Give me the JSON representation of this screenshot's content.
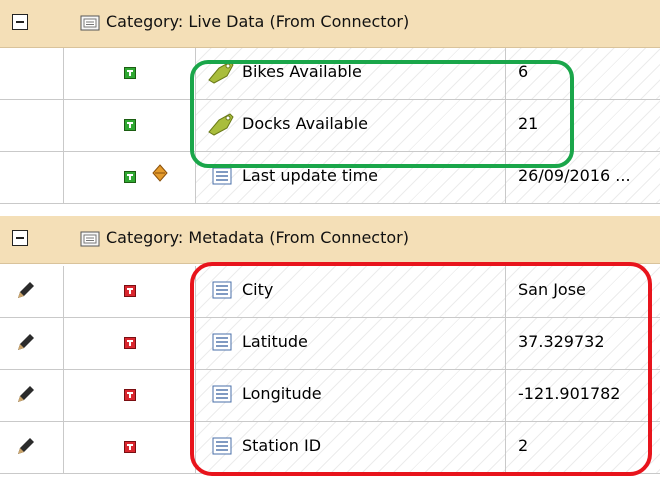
{
  "categories": [
    {
      "label": "Category: Live Data (From Connector)",
      "properties": [
        {
          "name": "Bikes Available",
          "value": "6",
          "icon": "tag-icon",
          "status": [
            "green-square-icon"
          ]
        },
        {
          "name": "Docks Available",
          "value": "21",
          "icon": "tag-icon",
          "status": [
            "green-square-icon"
          ]
        },
        {
          "name": "Last update time",
          "value": "26/09/2016 ...",
          "icon": "list-icon",
          "status": [
            "green-square-icon",
            "diamond-icon"
          ]
        }
      ]
    },
    {
      "label": "Category: Metadata (From Connector)",
      "properties": [
        {
          "name": "City",
          "value": "San Jose",
          "icon": "list-icon",
          "status": [
            "pencil-icon",
            "red-square-icon"
          ]
        },
        {
          "name": "Latitude",
          "value": "37.329732",
          "icon": "list-icon",
          "status": [
            "pencil-icon",
            "red-square-icon"
          ]
        },
        {
          "name": "Longitude",
          "value": "-121.901782",
          "icon": "list-icon",
          "status": [
            "pencil-icon",
            "red-square-icon"
          ]
        },
        {
          "name": "Station ID",
          "value": "2",
          "icon": "list-icon",
          "status": [
            "pencil-icon",
            "red-square-icon"
          ]
        }
      ]
    }
  ],
  "colors": {
    "category_bg": "#f4dfb7",
    "highlight_live": "#1aa64a",
    "highlight_meta": "#e8141c",
    "status_green": "#2fa832",
    "status_red": "#d9262e"
  }
}
